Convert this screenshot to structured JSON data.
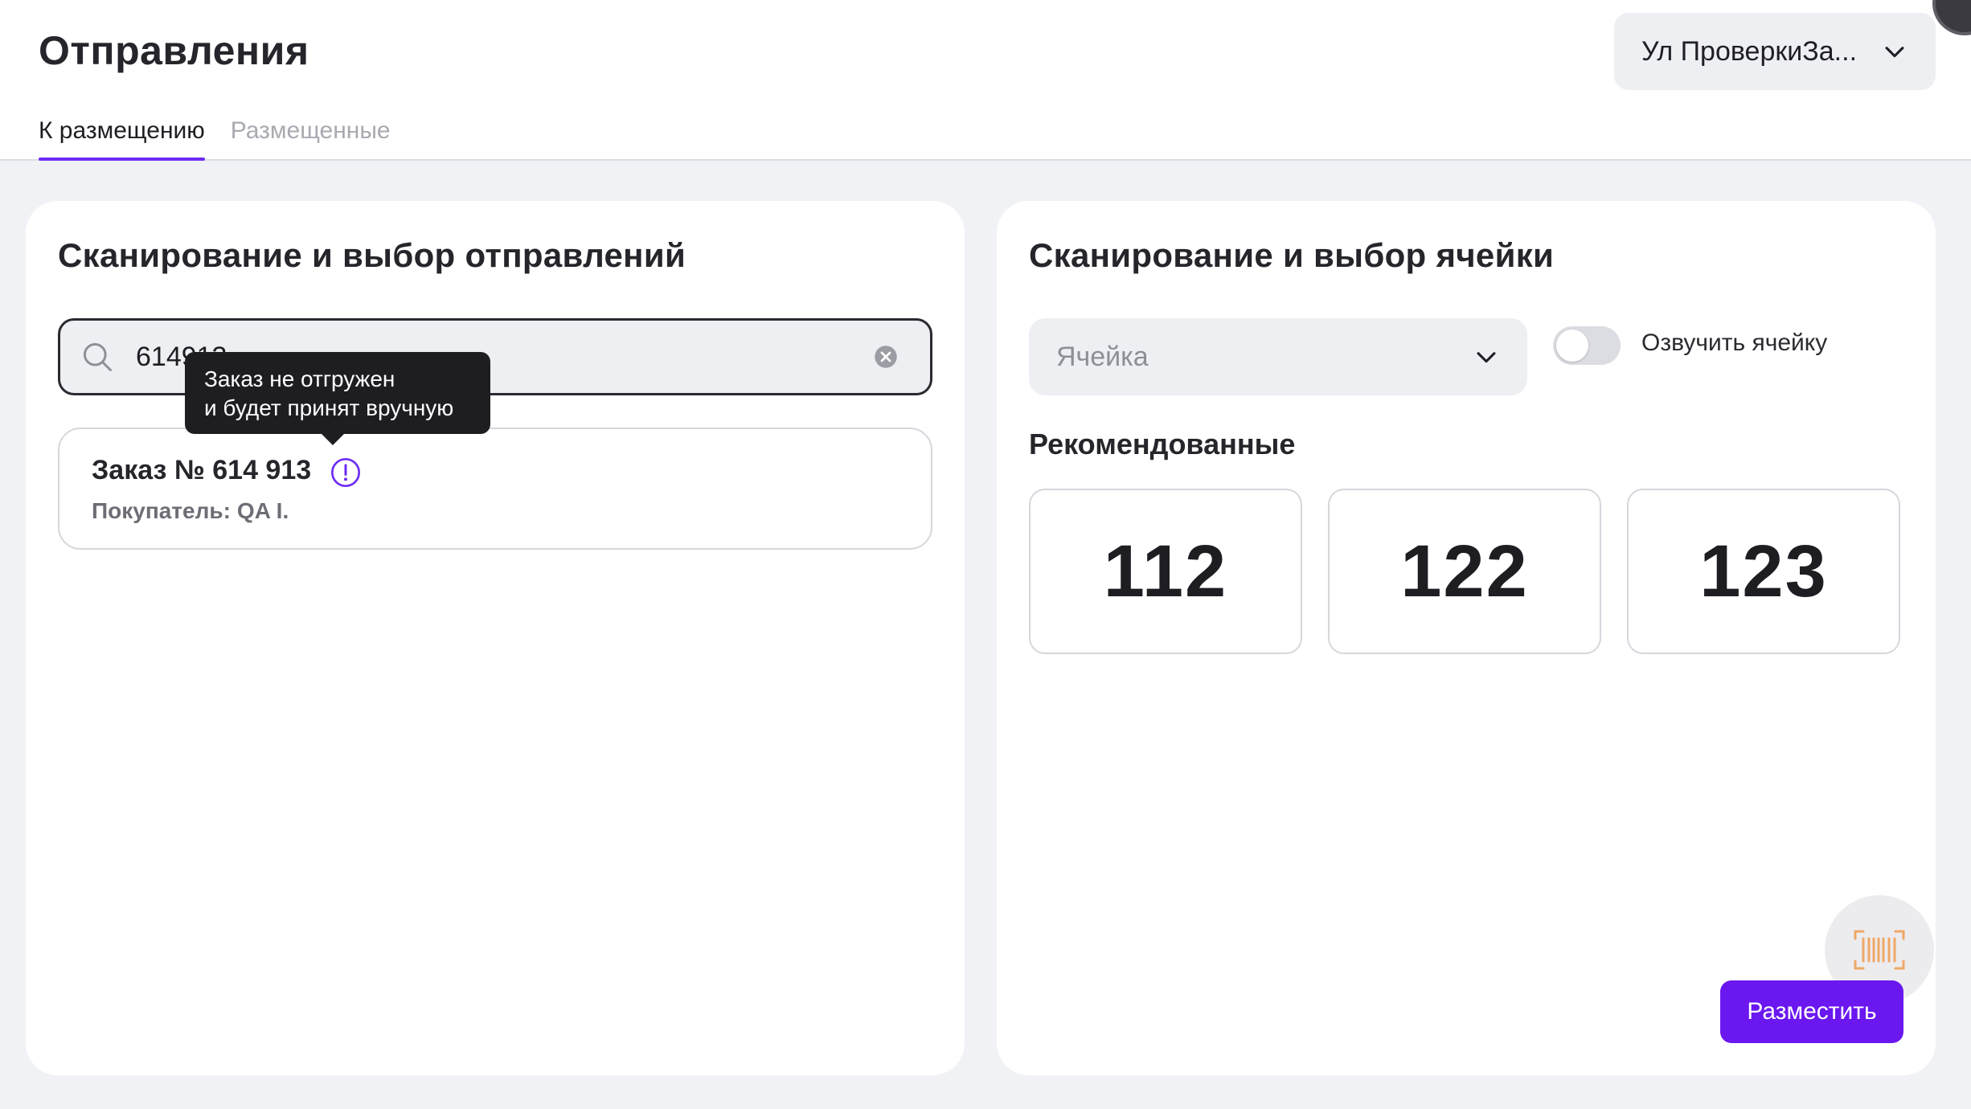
{
  "header": {
    "title": "Отправления",
    "store_select": {
      "value": "Ул ПроверкиЗа..."
    }
  },
  "tabs": [
    {
      "label": "К размещению",
      "active": true
    },
    {
      "label": "Размещенные",
      "active": false
    }
  ],
  "left_panel": {
    "title": "Сканирование и выбор отправлений",
    "search": {
      "value": "614913"
    },
    "tooltip": {
      "line1": "Заказ не отгружен",
      "line2": "и будет принят вручную"
    },
    "order": {
      "title": "Заказ № 614 913",
      "buyer_label": "Покупатель:",
      "buyer_value": "QA I."
    }
  },
  "right_panel": {
    "title": "Сканирование и выбор ячейки",
    "cell_select": {
      "placeholder": "Ячейка"
    },
    "announce_toggle": {
      "label": "Озвучить ячейку",
      "on": false
    },
    "recommended_title": "Рекомендованные",
    "recommended_cells": [
      "112",
      "122",
      "123"
    ],
    "place_button": "Разместить"
  },
  "colors": {
    "accent": "#6d2cf4",
    "button": "#6a17f0",
    "scan_icon": "#f0a766",
    "background": "#f1f2f6"
  },
  "icons": {
    "store_select": "chevron-down-icon",
    "search": "search-icon",
    "clear": "clear-circle-icon",
    "order_info": "info-exclamation-icon",
    "cell_select": "chevron-down-icon",
    "scan": "barcode-scan-icon"
  }
}
